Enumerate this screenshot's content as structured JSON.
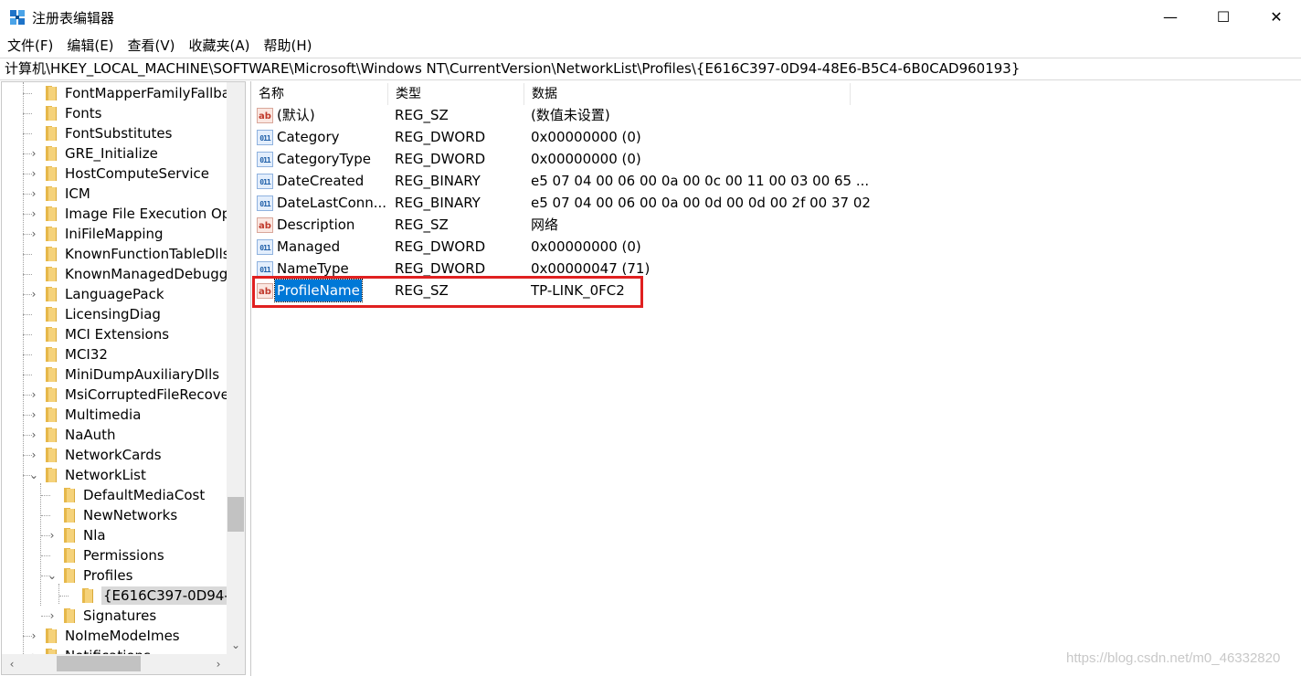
{
  "window": {
    "title": "注册表编辑器",
    "minimize_label": "—",
    "maximize_label": "☐",
    "close_label": "✕"
  },
  "menu": [
    {
      "label": "文件(F)"
    },
    {
      "label": "编辑(E)"
    },
    {
      "label": "查看(V)"
    },
    {
      "label": "收藏夹(A)"
    },
    {
      "label": "帮助(H)"
    }
  ],
  "address": "计算机\\HKEY_LOCAL_MACHINE\\SOFTWARE\\Microsoft\\Windows NT\\CurrentVersion\\NetworkList\\Profiles\\{E616C397-0D94-48E6-B5C4-6B0CAD960193}",
  "tree": {
    "items": [
      {
        "label": "FontMapperFamilyFallba",
        "expander": ""
      },
      {
        "label": "Fonts",
        "expander": ""
      },
      {
        "label": "FontSubstitutes",
        "expander": ""
      },
      {
        "label": "GRE_Initialize",
        "expander": "›"
      },
      {
        "label": "HostComputeService",
        "expander": "›"
      },
      {
        "label": "ICM",
        "expander": "›"
      },
      {
        "label": "Image File Execution Op",
        "expander": "›"
      },
      {
        "label": "IniFileMapping",
        "expander": "›"
      },
      {
        "label": "KnownFunctionTableDlls",
        "expander": ""
      },
      {
        "label": "KnownManagedDebugg",
        "expander": ""
      },
      {
        "label": "LanguagePack",
        "expander": "›"
      },
      {
        "label": "LicensingDiag",
        "expander": ""
      },
      {
        "label": "MCI Extensions",
        "expander": ""
      },
      {
        "label": "MCI32",
        "expander": ""
      },
      {
        "label": "MiniDumpAuxiliaryDlls",
        "expander": ""
      },
      {
        "label": "MsiCorruptedFileRecove",
        "expander": "›"
      },
      {
        "label": "Multimedia",
        "expander": "›"
      },
      {
        "label": "NaAuth",
        "expander": "›"
      },
      {
        "label": "NetworkCards",
        "expander": "›"
      },
      {
        "label": "NetworkList",
        "expander": "⌄"
      },
      {
        "label": "DefaultMediaCost",
        "expander": ""
      },
      {
        "label": "NewNetworks",
        "expander": ""
      },
      {
        "label": "Nla",
        "expander": "›"
      },
      {
        "label": "Permissions",
        "expander": ""
      },
      {
        "label": "Profiles",
        "expander": "⌄"
      },
      {
        "label": "{E616C397-0D94-4",
        "expander": ""
      },
      {
        "label": "Signatures",
        "expander": "›"
      },
      {
        "label": "NoImeModeImes",
        "expander": "›"
      },
      {
        "label": "Notifications",
        "expander": "›"
      }
    ],
    "scroll_down": "⌄",
    "scroll_left": "‹",
    "scroll_right": "›"
  },
  "values": {
    "headers": {
      "name": "名称",
      "type": "类型",
      "data": "数据"
    },
    "rows": [
      {
        "icon": "ab",
        "name": "(默认)",
        "type": "REG_SZ",
        "data": "(数值未设置)"
      },
      {
        "icon": "011",
        "name": "Category",
        "type": "REG_DWORD",
        "data": "0x00000000 (0)"
      },
      {
        "icon": "011",
        "name": "CategoryType",
        "type": "REG_DWORD",
        "data": "0x00000000 (0)"
      },
      {
        "icon": "011",
        "name": "DateCreated",
        "type": "REG_BINARY",
        "data": "e5 07 04 00 06 00 0a 00 0c 00 11 00 03 00 65 ..."
      },
      {
        "icon": "011",
        "name": "DateLastConn...",
        "type": "REG_BINARY",
        "data": "e5 07 04 00 06 00 0a 00 0d 00 0d 00 2f 00 37 02"
      },
      {
        "icon": "ab",
        "name": "Description",
        "type": "REG_SZ",
        "data": "网络"
      },
      {
        "icon": "011",
        "name": "Managed",
        "type": "REG_DWORD",
        "data": "0x00000000 (0)"
      },
      {
        "icon": "011",
        "name": "NameType",
        "type": "REG_DWORD",
        "data": "0x00000047 (71)"
      },
      {
        "icon": "ab",
        "name": "ProfileName",
        "type": "REG_SZ",
        "data": "TP-LINK_0FC2"
      }
    ]
  },
  "watermark": "https://blog.csdn.net/m0_46332820"
}
